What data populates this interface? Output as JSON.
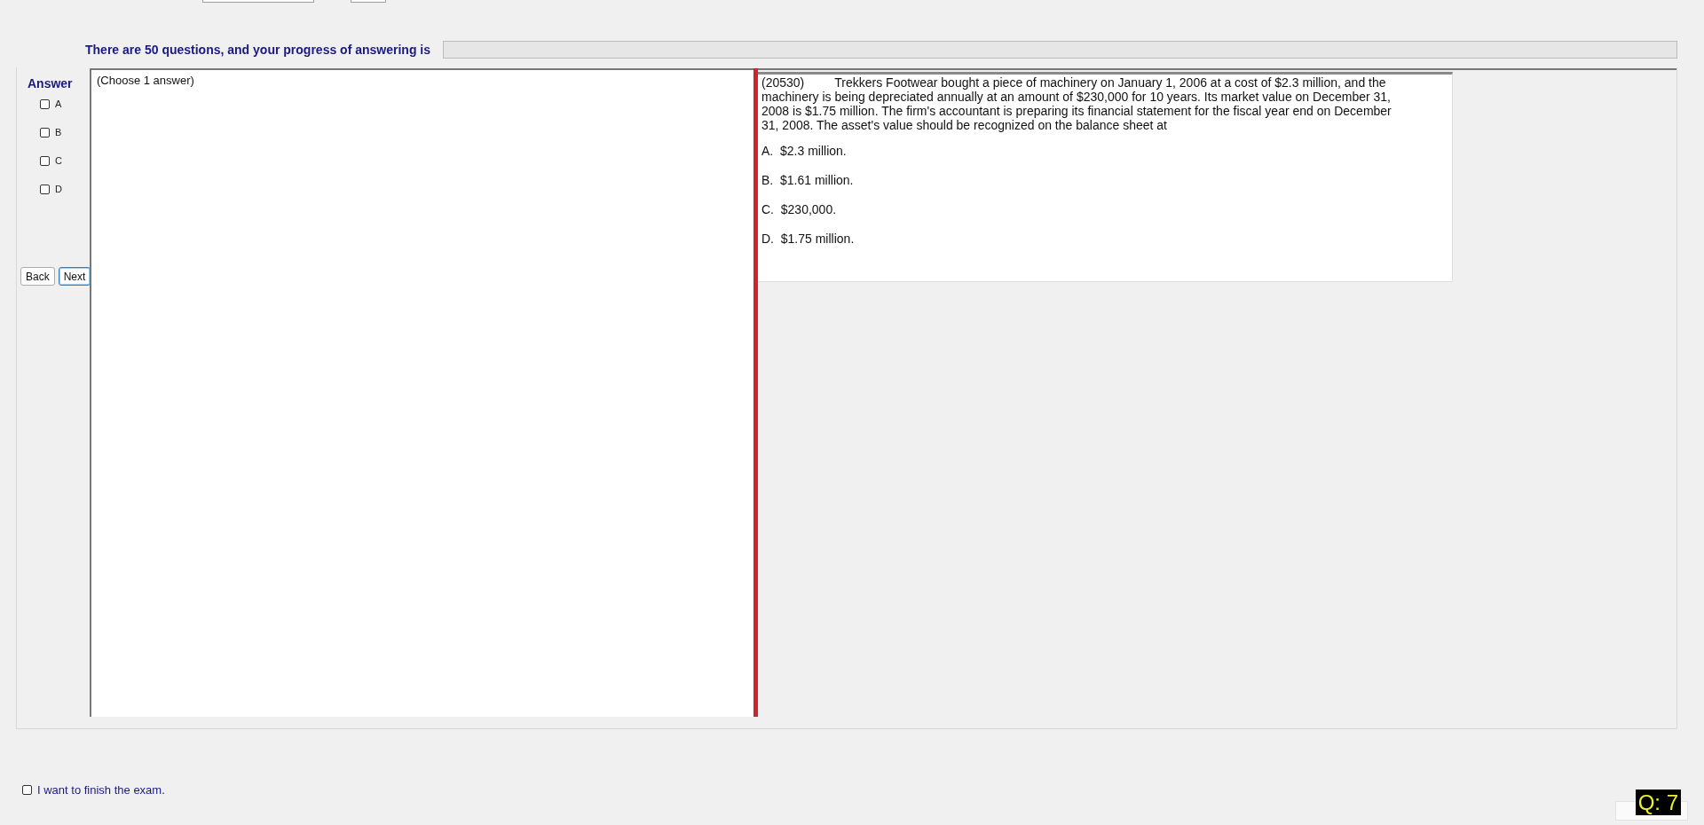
{
  "progress": {
    "label": "There are 50 questions, and your progress of answering is",
    "level": 0
  },
  "answer_panel": {
    "title": "Answer",
    "options": [
      {
        "label": "A",
        "checked": false
      },
      {
        "label": "B",
        "checked": false
      },
      {
        "label": "C",
        "checked": false
      },
      {
        "label": "D",
        "checked": false
      }
    ]
  },
  "buttons": [
    {
      "label": "Back",
      "selected": false
    },
    {
      "label": "Next",
      "selected": true
    }
  ],
  "instruction": "(Choose 1 answer)",
  "question": {
    "id": "(20530)",
    "text": "Trekkers Footwear bought a piece of machinery on January 1, 2006 at a cost of $2.3 million, and the machinery is being depreciated annually at an amount of $230,000 for 10 years. Its market value on December 31, 2008 is $1.75 million. The firm's accountant is preparing its financial statement for the fiscal year end on December 31, 2008. The asset's value should be recognized on the balance sheet at",
    "choices": [
      "A.  $2.3 million.",
      "B.  $1.61 million.",
      "C.  $230,000.",
      "D.  $1.75 million."
    ]
  },
  "finish": {
    "label": "I want to finish the exam.",
    "checked": false
  },
  "question_number": "Q: 7"
}
